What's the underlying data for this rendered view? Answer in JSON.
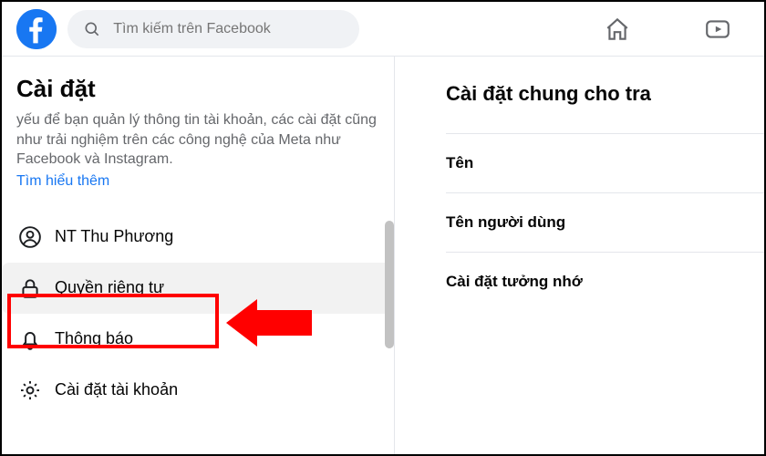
{
  "topbar": {
    "search_placeholder": "Tìm kiếm trên Facebook"
  },
  "sidebar": {
    "title": "Cài đặt",
    "description": "yếu để bạn quản lý thông tin tài khoản, các cài đặt cũng như trải nghiệm trên các công nghệ của Meta như Facebook và Instagram.",
    "learn_more": "Tìm hiểu thêm",
    "items": [
      {
        "label": "NT Thu Phương"
      },
      {
        "label": "Quyền riêng tư"
      },
      {
        "label": "Thông báo"
      },
      {
        "label": "Cài đặt tài khoản"
      }
    ]
  },
  "main": {
    "heading": "Cài đặt chung cho tra",
    "rows": [
      {
        "label": "Tên"
      },
      {
        "label": "Tên người dùng"
      },
      {
        "label": "Cài đặt tưởng nhớ"
      }
    ]
  }
}
